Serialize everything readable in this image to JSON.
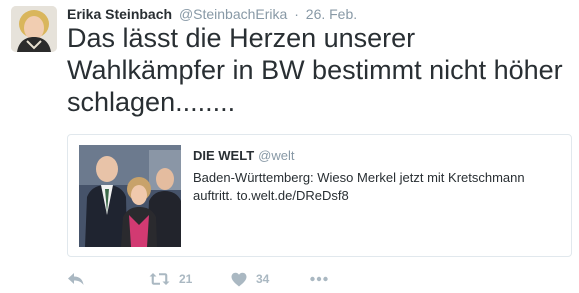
{
  "tweet": {
    "author_name": "Erika Steinbach",
    "author_handle": "@SteinbachErika",
    "separator": "·",
    "date": "26. Feb.",
    "text": "Das lässt die Herzen unserer Wahlkämpfer in BW bestimmt nicht höher schlagen........"
  },
  "card": {
    "source_name": "DIE WELT",
    "source_handle": "@welt",
    "text": "Baden-Württemberg: Wieso Merkel jetzt mit Kretschmann auftritt.",
    "link": "to.welt.de/DReDsf8"
  },
  "actions": {
    "reply_icon": "reply-icon",
    "retweet_icon": "retweet-icon",
    "retweet_count": "21",
    "like_icon": "heart-icon",
    "like_count": "34",
    "more_icon": "more-icon"
  },
  "colors": {
    "text": "#292f33",
    "muted": "#8899a6",
    "icon": "#aab8c2",
    "border": "#e1e8ed"
  }
}
